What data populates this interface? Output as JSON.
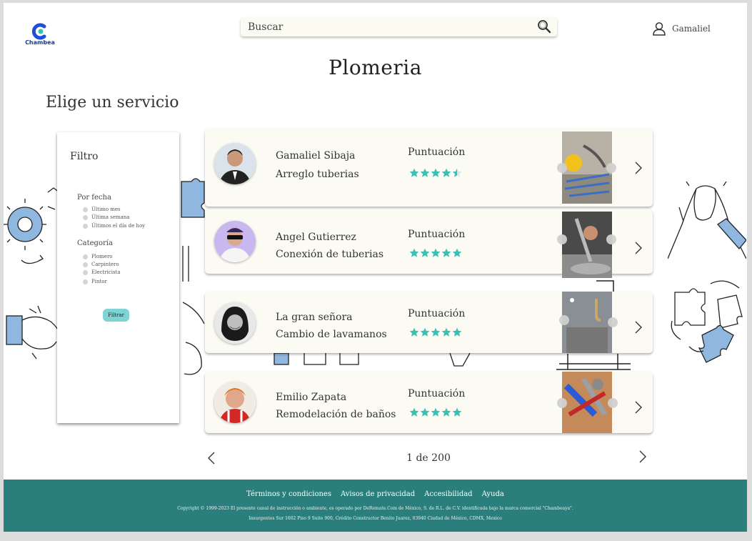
{
  "header": {
    "logo_text": "Chambea",
    "search_placeholder": "Buscar",
    "user_name": "Gamaliel"
  },
  "page_title": "Plomeria",
  "section_title": "Elige un servicio",
  "filter": {
    "title": "Filtro",
    "by_date_title": "Por fecha",
    "date_options": [
      "Último mes",
      "Última semana",
      "Últimos el día de hoy"
    ],
    "category_title": "Categoría",
    "category_options": [
      "Plomero",
      "Carpintero",
      "Electricista",
      "Pintor"
    ],
    "button_label": "Filtrar"
  },
  "cards": [
    {
      "name": "Gamaliel Sibaja",
      "service": "Arreglo tuberias",
      "score_label": "Puntuación",
      "rating": 4.5
    },
    {
      "name": "Angel Gutierrez",
      "service": "Conexión de tuberias",
      "score_label": "Puntuación",
      "rating": 5
    },
    {
      "name": "La gran señora",
      "service": "Cambio de lavamanos",
      "score_label": "Puntuación",
      "rating": 5
    },
    {
      "name": "Emilio  Zapata",
      "service": "Remodelación de baños",
      "score_label": "Puntuación",
      "rating": 5
    }
  ],
  "pagination": {
    "text": "1 de 200"
  },
  "footer": {
    "links": [
      "Términos y condiciones",
      "Avisos de privacidad",
      "Accesibilidad",
      "Ayuda"
    ],
    "copyright": "Copyright © 1999-2023 El presente canal de instrucción o ambiente, es operado por DeRemate.Com de México, S. de R.L. de C.V. identificada bajo la marca comercial \"Chambeaya\".",
    "address": "Insurgentes Sur 1602 Piso 9 Suite 900, Crédito Constructor Benito Juarez, 03940 Ciudad de México, CDMX, Mexico"
  },
  "colors": {
    "star": "#3cbfb4",
    "footer_bg": "#2a7f7c",
    "filter_button": "#7fd3d3",
    "card_bg": "#fbfbf3"
  },
  "icons": [
    "chambea-logo-icon",
    "search-icon",
    "user-icon",
    "chevron-right-icon",
    "chevron-left-icon",
    "star-icon"
  ]
}
